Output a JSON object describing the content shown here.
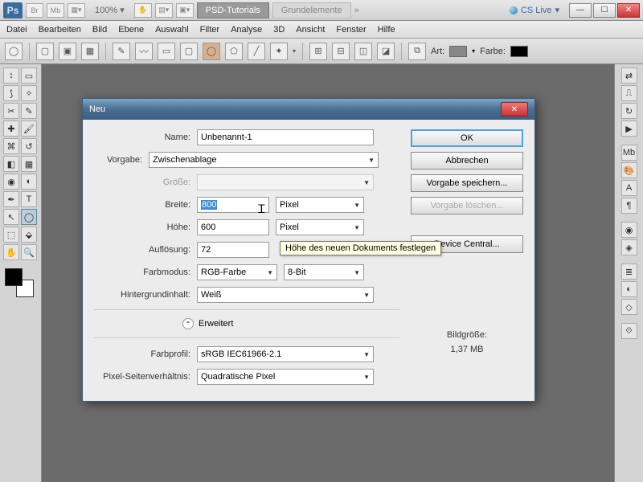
{
  "appbar": {
    "zoom": "100%",
    "tab_active": "PSD-Tutorials",
    "tab_inactive": "Grundelemente",
    "cs_live": "CS Live"
  },
  "menu": {
    "datei": "Datei",
    "bearbeiten": "Bearbeiten",
    "bild": "Bild",
    "ebene": "Ebene",
    "auswahl": "Auswahl",
    "filter": "Filter",
    "analyse": "Analyse",
    "dreid": "3D",
    "ansicht": "Ansicht",
    "fenster": "Fenster",
    "hilfe": "Hilfe"
  },
  "options": {
    "art": "Art:",
    "farbe": "Farbe:"
  },
  "dialog": {
    "title": "Neu",
    "labels": {
      "name": "Name:",
      "vorgabe": "Vorgabe:",
      "groesse": "Größe:",
      "breite": "Breite:",
      "hoehe": "Höhe:",
      "aufloesung": "Auflösung:",
      "farbmodus": "Farbmodus:",
      "hintergrund": "Hintergrundinhalt:",
      "erweitert": "Erweitert",
      "farbprofil": "Farbprofil:",
      "pixelsv": "Pixel-Seitenverhältnis:"
    },
    "values": {
      "name": "Unbenannt-1",
      "vorgabe": "Zwischenablage",
      "breite": "800",
      "breite_unit": "Pixel",
      "hoehe": "600",
      "hoehe_unit": "Pixel",
      "aufloesung": "72",
      "farbmodus_mode": "RGB-Farbe",
      "farbmodus_depth": "8-Bit",
      "hintergrund": "Weiß",
      "farbprofil": "sRGB IEC61966-2.1",
      "pixelsv": "Quadratische Pixel"
    },
    "buttons": {
      "ok": "OK",
      "abbrechen": "Abbrechen",
      "speichern": "Vorgabe speichern...",
      "loeschen": "Vorgabe löschen...",
      "device": "Device Central..."
    },
    "size_label": "Bildgröße:",
    "size_value": "1,37 MB",
    "tooltip": "Höhe des neuen Dokuments festlegen"
  }
}
